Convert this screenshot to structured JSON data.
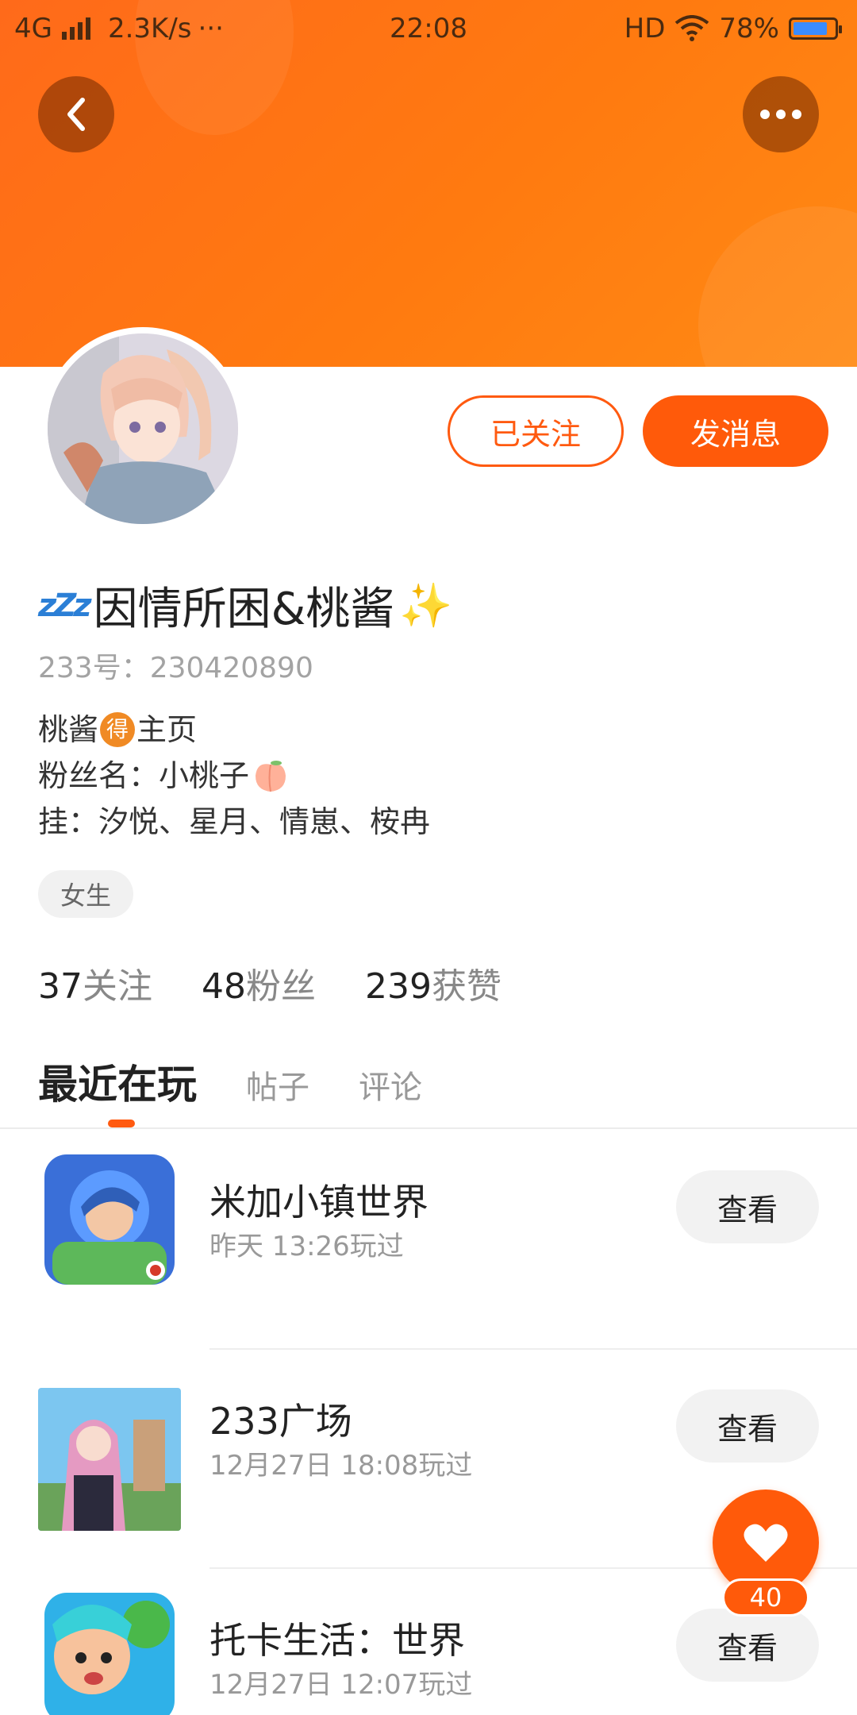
{
  "status_bar": {
    "network": "4G",
    "speed": "2.3K/s",
    "more": "···",
    "time": "22:08",
    "hd": "HD",
    "battery": "78%"
  },
  "header": {
    "back_icon": "chevron-left-icon",
    "more_icon": "more-dots-icon"
  },
  "profile": {
    "name": "因情所困&桃酱",
    "name_prefix_emoji": "zzz",
    "name_suffix_emoji": "✨",
    "uid_label": "233号：",
    "uid": "230420890",
    "bio": {
      "line1_a": "桃酱",
      "line1_badge": "得",
      "line1_b": "主页",
      "line2": "粉丝名：小桃子",
      "line3": "挂：汐悦、星月、情崽、桉冉"
    },
    "gender_tag": "女生",
    "followed_label": "已关注",
    "message_label": "发消息",
    "stats": {
      "following_num": "37",
      "following_label": "关注",
      "fans_num": "48",
      "fans_label": "粉丝",
      "likes_num": "239",
      "likes_label": "获赞"
    }
  },
  "tabs": [
    {
      "label": "最近在玩",
      "active": true
    },
    {
      "label": "帖子",
      "active": false
    },
    {
      "label": "评论",
      "active": false
    }
  ],
  "games": [
    {
      "title": "米加小镇世界",
      "played": "昨天 13:26玩过",
      "button": "查看"
    },
    {
      "title": "233广场",
      "played": "12月27日 18:08玩过",
      "button": "查看"
    },
    {
      "title": "托卡生活：世界",
      "played": "12月27日 12:07玩过",
      "button": "查看"
    }
  ],
  "fab": {
    "icon": "heart-icon",
    "count": "40"
  },
  "colors": {
    "accent": "#ff5a0a",
    "header": "#ff7a10"
  }
}
